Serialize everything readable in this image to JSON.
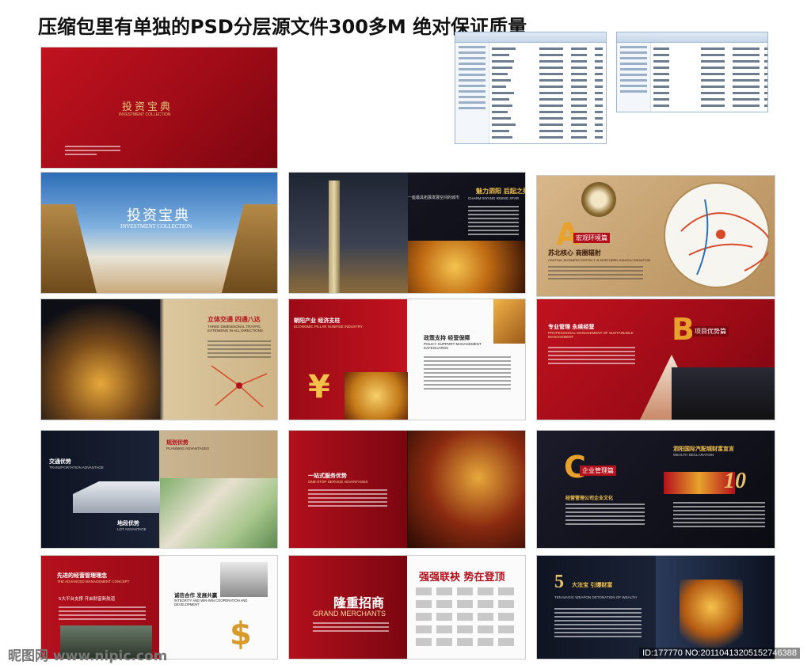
{
  "header": {
    "title": "压缩包里有单独的PSD分层源文件300多M 绝对保证质量"
  },
  "cover": {
    "logo_cn": "投资宝典",
    "logo_en": "INVESTMENT COLLECTION"
  },
  "spread1": {
    "logo_cn": "投资宝典",
    "logo_en": "INVESTMENT COLLECTION"
  },
  "spread2": {
    "heading": "魅力泗阳 后起之秀",
    "sub": "CHARM SIYANG RISING STAR",
    "quote": "一座最具拓展发展空间的城市"
  },
  "spread3": {
    "badge": "宏观环境篇",
    "letter": "A",
    "heading": "苏北核心 商圈辐射",
    "sub": "CENTRAL BUSINESS DISTRICT IN NORTHERN JIANGSU RADIATION"
  },
  "spread4": {
    "heading": "立体交通 四通八达",
    "sub": "THREE DIMENSIONAL TRAFFIC EXTENDING IN ALL DIRECTIONS"
  },
  "spread5": {
    "heading": "朝阳产业 经济支柱",
    "sub": "ECONOMIC PILLAR SUNRISE INDUSTRY",
    "heading2": "政策支持 经营保障",
    "sub2": "POLICY SUPPORT MANAGEMENT SAFEGUARDS"
  },
  "spread6": {
    "heading": "专业管理 永续经营",
    "sub": "PROFESSIONAL MANAGEMENT OF SUSTAINABLE MANAGEMENT",
    "badge": "项目优势篇",
    "letter": "B"
  },
  "spread7": {
    "heading": "交通优势",
    "sub": "TRANSPORTATION ADVANTAGE",
    "heading2": "规划优势",
    "sub2": "PLANNING ADVANTAGES",
    "heading3": "地段优势",
    "sub3": "LOT ADVANTAGE"
  },
  "spread8": {
    "heading": "一站式服务优势",
    "sub": "ONE-STOP SERVICE ADVANTAGES"
  },
  "spread9": {
    "badge": "企业管理篇",
    "letter": "C",
    "heading": "经营管理公司企业文化",
    "heading2": "泗阳国际汽配城财富宣言",
    "sub2": "WEALTH DECLARATION",
    "number": "10"
  },
  "spread10": {
    "heading": "先进的经营管理理念",
    "sub": "THE ADVANCED MANAGEMENT CONCEPT",
    "heading2": "诚信合作 发展共赢",
    "sub2": "INTEGRITY AND WIN-WIN COOPERATION AND DEVELOPMENT",
    "tagline": "5大平台支撑 开启财富新航道"
  },
  "spread11": {
    "heading": "隆重招商",
    "sub": "GRAND MERCHANTS",
    "heading2": "强强联袂 势在登顶"
  },
  "spread12": {
    "number": "5",
    "heading": "大法宝 引爆财富",
    "sub": "TEN MAGIC WEAPON DETONATION OF WEALTH"
  },
  "footer": {
    "watermark": "昵图网 www.nipic.com",
    "image_id": "ID:177770 NO:20110413205152746388"
  },
  "colors": {
    "brand_red": "#b3101c",
    "gold": "#e5b64a",
    "dark": "#0f0f18"
  }
}
